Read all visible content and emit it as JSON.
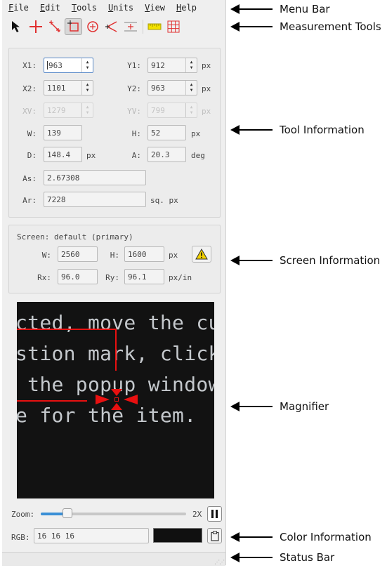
{
  "menu": [
    {
      "accel": "F",
      "rest": "ile"
    },
    {
      "accel": "E",
      "rest": "dit"
    },
    {
      "accel": "T",
      "rest": "ools"
    },
    {
      "accel": "U",
      "rest": "nits"
    },
    {
      "accel": "V",
      "rest": "iew"
    },
    {
      "accel": "H",
      "rest": "elp"
    }
  ],
  "toolbar": {
    "tools": [
      "pointer-icon",
      "point-icon",
      "line-icon",
      "rectangle-icon",
      "circle-icon",
      "angle-icon",
      "grid-icon",
      "ruler-icon",
      "grid-overlay-icon"
    ],
    "active": "rectangle-icon"
  },
  "tool_info": {
    "x1": {
      "label": "X1:",
      "value": "963"
    },
    "y1": {
      "label": "Y1:",
      "value": "912"
    },
    "x2": {
      "label": "X2:",
      "value": "1101"
    },
    "y2": {
      "label": "Y2:",
      "value": "963"
    },
    "xv": {
      "label": "XV:",
      "value": "1279"
    },
    "yv": {
      "label": "YV:",
      "value": "799"
    },
    "w": {
      "label": "W:",
      "value": "139"
    },
    "h": {
      "label": "H:",
      "value": "52"
    },
    "d": {
      "label": "D:",
      "value": "148.4"
    },
    "a": {
      "label": "A:",
      "value": "20.3"
    },
    "as": {
      "label": "As:",
      "value": "2.67308"
    },
    "ar": {
      "label": "Ar:",
      "value": "7228"
    },
    "units": {
      "px": "px",
      "deg": "deg",
      "sqpx": "sq. px"
    }
  },
  "screen_info": {
    "title": "Screen: default (primary)",
    "w": {
      "label": "W:",
      "value": "2560"
    },
    "h": {
      "label": "H:",
      "value": "1600"
    },
    "rx": {
      "label": "Rx:",
      "value": "96.0"
    },
    "ry": {
      "label": "Ry:",
      "value": "96.1"
    },
    "unit_px": "px",
    "unit_pxin": "px/in"
  },
  "magnifier": {
    "lines": [
      "cted, move the cu",
      "stion mark, click",
      " the popup window",
      "e for the item."
    ]
  },
  "zoom": {
    "label": "Zoom:",
    "value": "2X",
    "level": 0.16
  },
  "color": {
    "label": "RGB:",
    "value": "16 16 16",
    "swatch": "#101010"
  },
  "callouts": {
    "menu_bar": "Menu Bar",
    "measurement_tools": "Measurement Tools",
    "tool_information": "Tool Information",
    "screen_information": "Screen Information",
    "magnifier": "Magnifier",
    "color_information": "Color Information",
    "status_bar": "Status Bar"
  }
}
